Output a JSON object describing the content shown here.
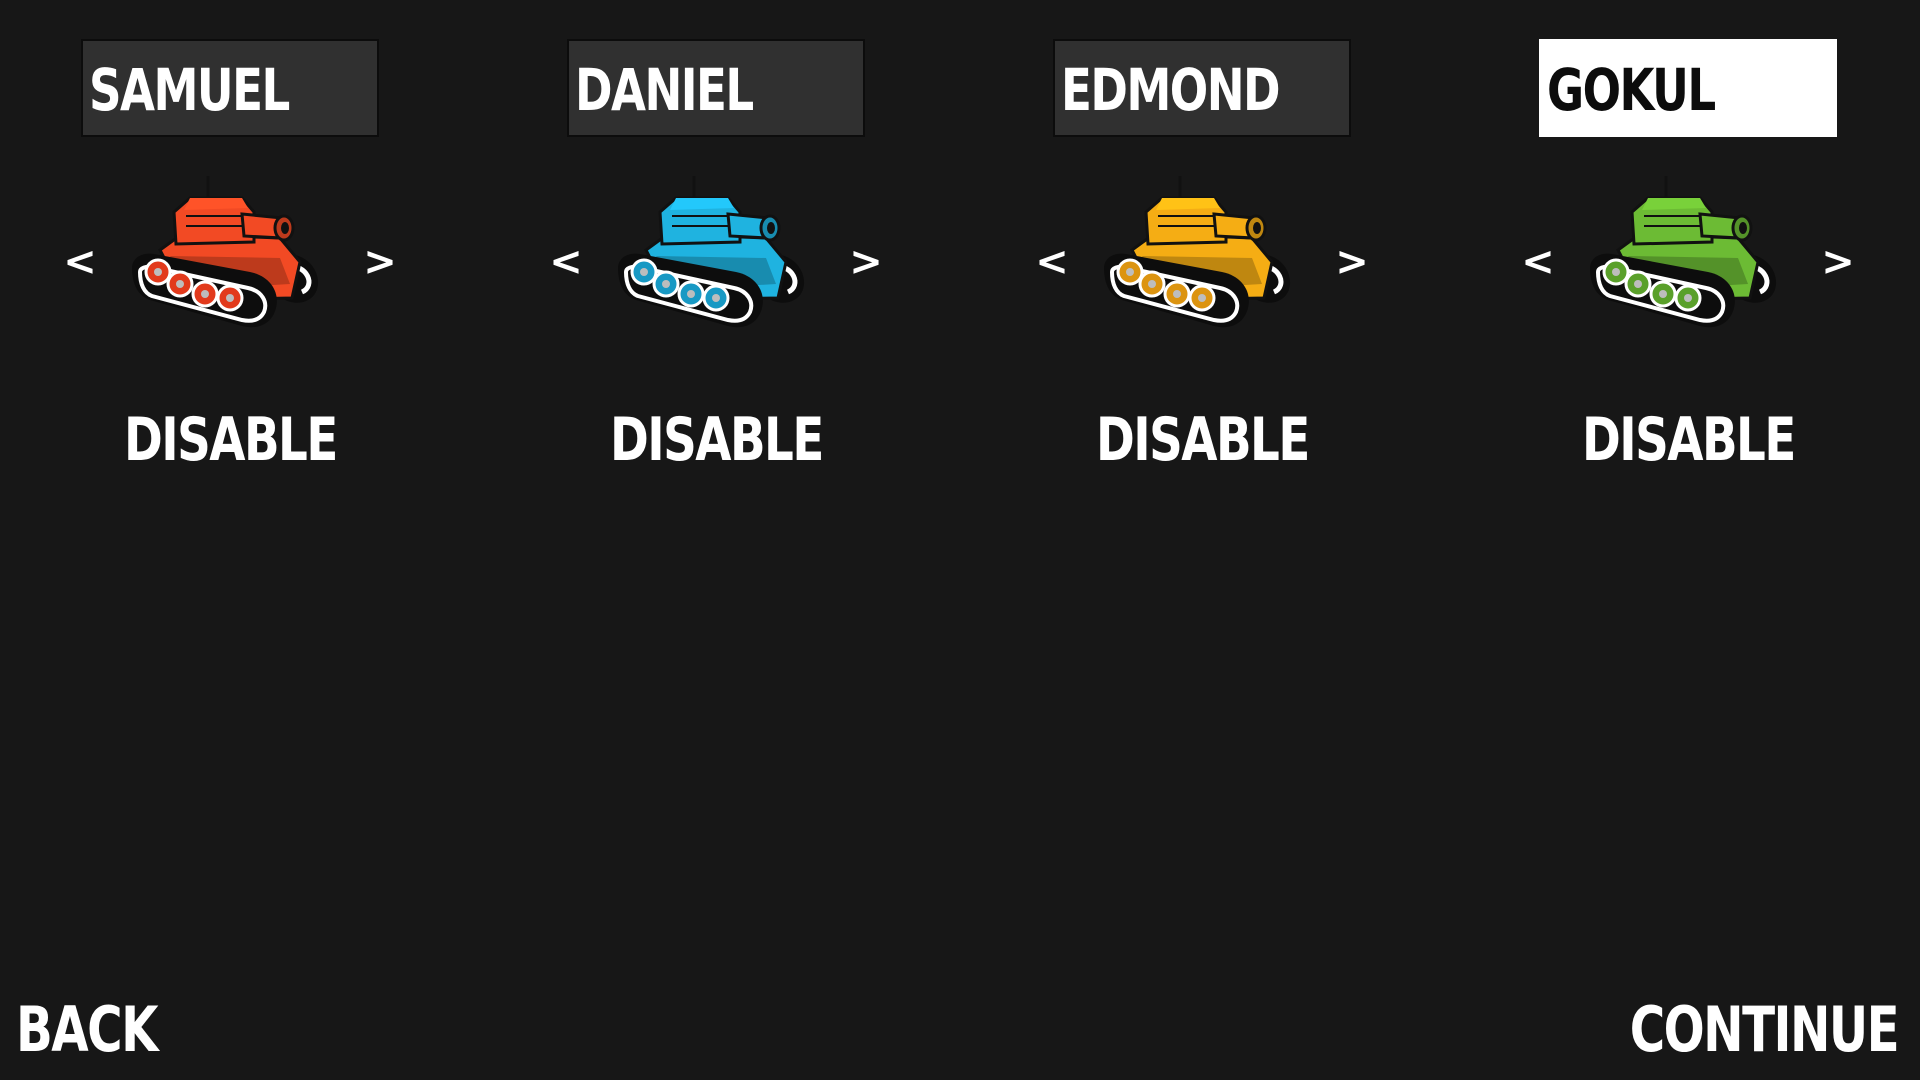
{
  "players": [
    {
      "name": "SAMUEL",
      "toggle_label": "DISABLE",
      "prev_label": "<",
      "next_label": ">",
      "color": "#f24a24",
      "wheel_color": "#e23a1c",
      "active": false
    },
    {
      "name": "DANIEL",
      "toggle_label": "DISABLE",
      "prev_label": "<",
      "next_label": ">",
      "color": "#1fb3e0",
      "wheel_color": "#1899c4",
      "active": false
    },
    {
      "name": "EDMOND",
      "toggle_label": "DISABLE",
      "prev_label": "<",
      "next_label": ">",
      "color": "#f5ad14",
      "wheel_color": "#dc9410",
      "active": false
    },
    {
      "name": "GOKUL",
      "toggle_label": "DISABLE",
      "prev_label": "<",
      "next_label": ">",
      "color": "#6cbb34",
      "wheel_color": "#5aa02a",
      "active": true
    }
  ],
  "footer": {
    "back_label": "BACK",
    "continue_label": "CONTINUE"
  },
  "colors": {
    "background": "#171717",
    "field_bg": "#303030",
    "field_active_bg": "#ffffff",
    "text": "#ffffff"
  }
}
